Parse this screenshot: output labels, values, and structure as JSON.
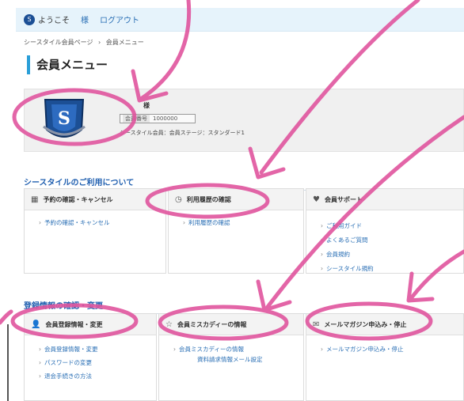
{
  "topbar": {
    "logo_text": "S",
    "welcome": "ようこそ",
    "user_suffix": "様",
    "logout": "ログアウト"
  },
  "breadcrumb": [
    "シースタイル会員ページ",
    "›",
    "会員メニュー"
  ],
  "page_title": "会員メニュー",
  "profile": {
    "name": "様",
    "member_id_label": "会員番号",
    "member_id_value": "1000000",
    "stage": "シースタイル会員：会員ステージ：スタンダード1"
  },
  "sections": [
    {
      "title": "シースタイルのご利用について",
      "cards": [
        {
          "icon": "calendar-icon",
          "title": "予約の確認・キャンセル",
          "links": [
            "予約の確認・キャンセル"
          ]
        },
        {
          "icon": "clock-icon",
          "title": "利用履歴の確認",
          "links": [
            "利用履歴の確認"
          ]
        },
        {
          "icon": "heart-icon",
          "title": "会員サポート",
          "links": [
            "ご利用ガイド",
            "よくあるご質問",
            "会員規約",
            "シースタイル規約"
          ]
        }
      ]
    },
    {
      "title": "登録情報の確認・変更",
      "cards": [
        {
          "icon": "person-icon",
          "title": "会員登録情報・変更",
          "links": [
            "会員登録情報・変更",
            "パスワードの変更",
            "退会手続きの方法"
          ]
        },
        {
          "icon": "star-icon",
          "title": "会員ミスカディーの情報",
          "links": [
            "会員ミスカディーの情報"
          ],
          "sub_link": "資料請求情報メール設定"
        },
        {
          "icon": "mail-icon",
          "title": "メールマガジン申込み・停止",
          "links": [
            "メールマガジン申込み・停止"
          ]
        }
      ]
    }
  ],
  "colors": {
    "accent": "#2a9fd8",
    "link": "#2a6fb5",
    "annotation": "#e0559e",
    "emblem": "#1c4f95"
  }
}
